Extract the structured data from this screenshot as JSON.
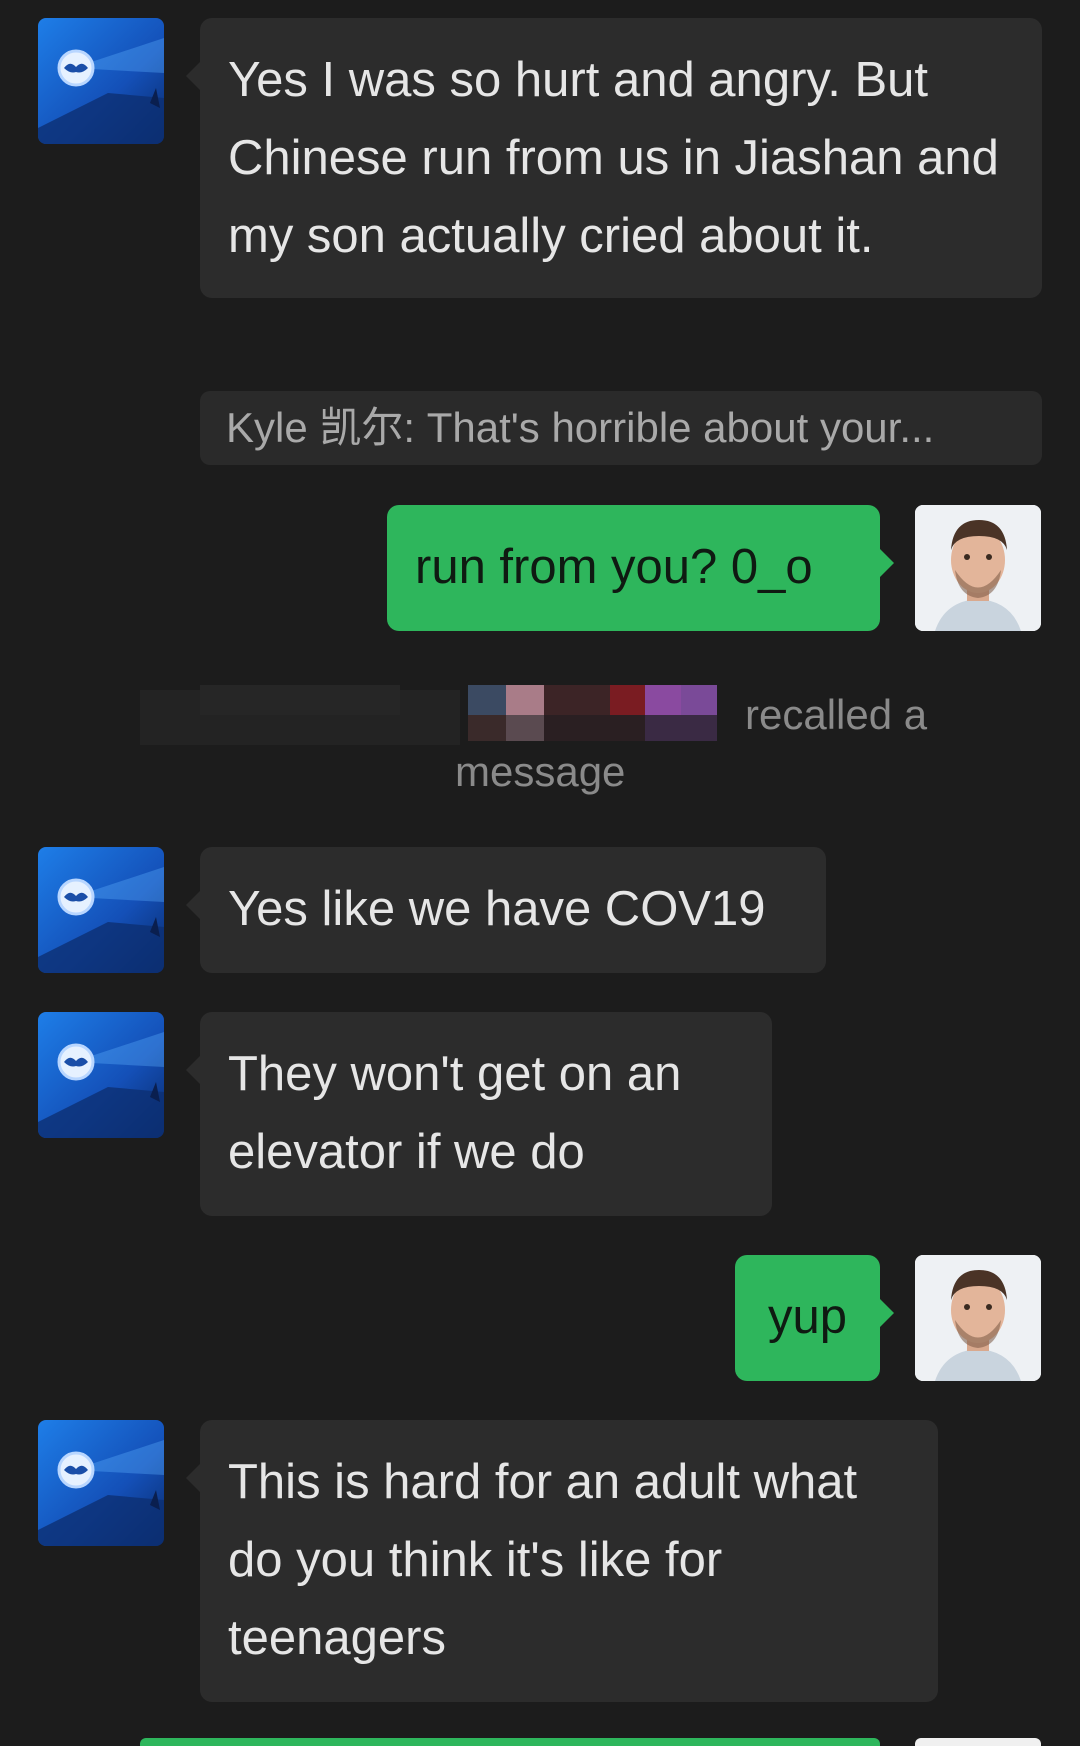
{
  "messages": [
    {
      "side": "in",
      "text": "Yes I was so hurt and angry. But Chinese run from us in Jiashan and my son actually cried about it."
    },
    {
      "side": "quote",
      "text": "Kyle 凯尔:  That's horrible about your..."
    },
    {
      "side": "out",
      "text": "run from you? 0_o"
    },
    {
      "side": "system",
      "text_a": "recalled a",
      "text_b": "message"
    },
    {
      "side": "in",
      "text": "Yes like we have COV19"
    },
    {
      "side": "in",
      "text": "They won't get on an elevator if we do"
    },
    {
      "side": "out",
      "text": "yup"
    },
    {
      "side": "in",
      "text": "This is hard for an adult what do you think it's like for teenagers"
    }
  ],
  "colors": {
    "background": "#1c1c1c",
    "incoming_bubble": "#2c2c2c",
    "outgoing_bubble": "#2eb65c",
    "system_text": "#8a8a8a"
  },
  "icons": {
    "contact_avatar": "batman-signal-avatar",
    "self_avatar": "man-portrait-avatar"
  }
}
